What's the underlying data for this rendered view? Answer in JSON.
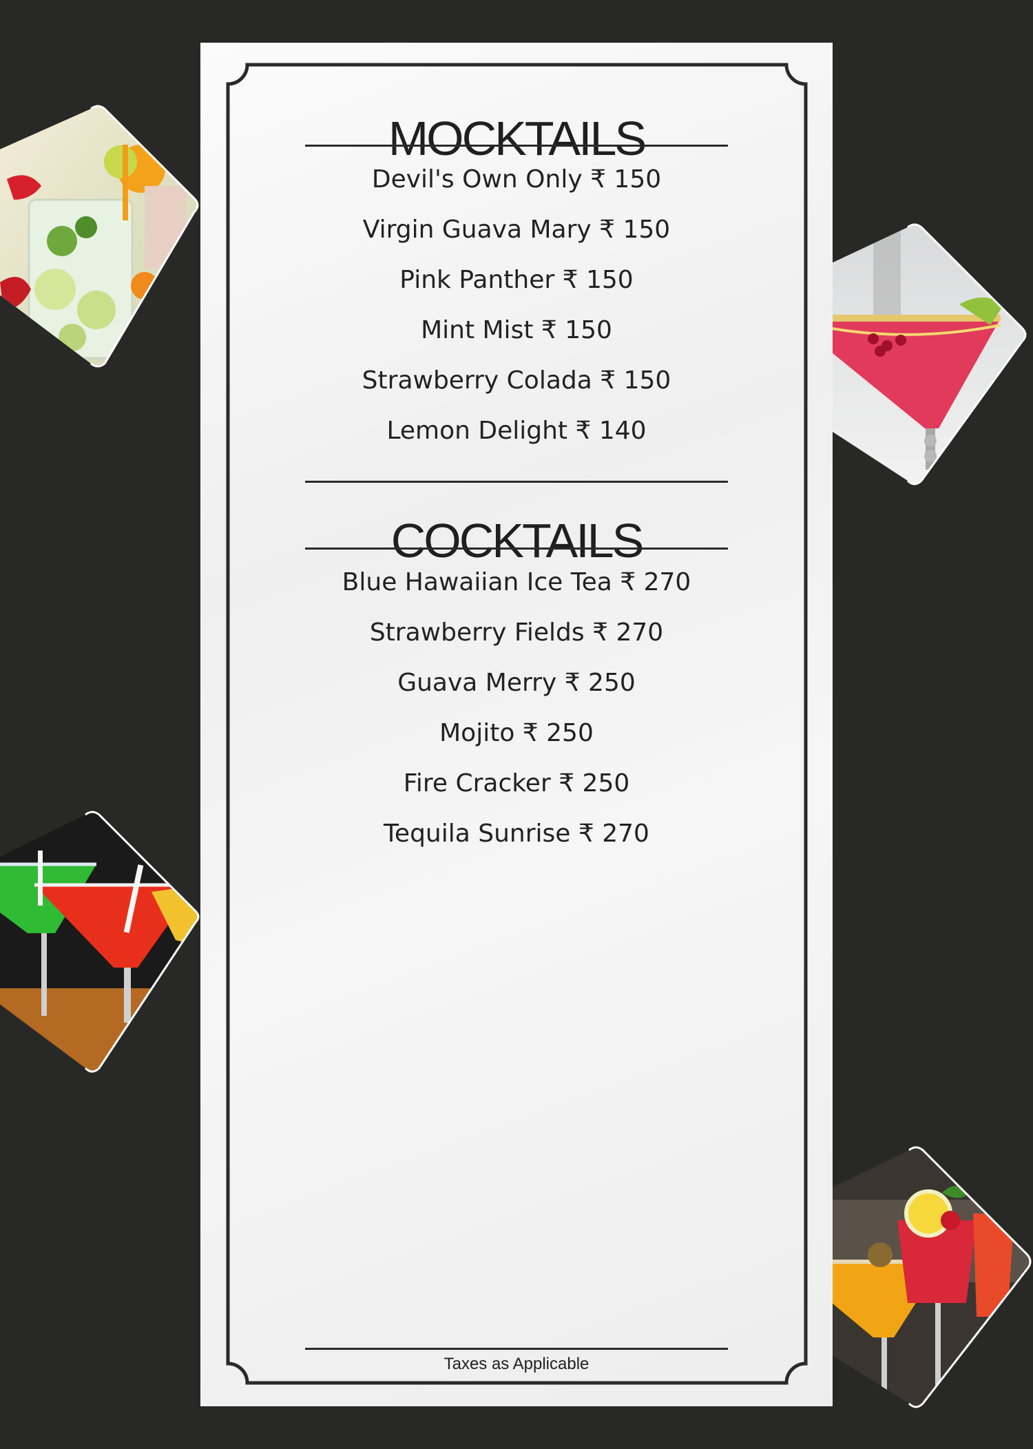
{
  "menu": {
    "mocktails": {
      "title": "MOCKTAILS",
      "items": [
        "Devil's Own Only ₹ 150",
        "Virgin Guava Mary ₹ 150",
        "Pink Panther ₹ 150",
        "Mint Mist ₹ 150",
        "Strawberry Colada ₹ 150",
        "Lemon Delight ₹ 140"
      ]
    },
    "cocktails": {
      "title": "COCKTAILS",
      "items": [
        "Blue Hawaiian Ice Tea ₹ 270",
        "Strawberry Fields ₹ 270",
        "Guava Merry ₹ 250",
        "Mojito ₹ 250",
        "Fire Cracker ₹ 250",
        "Tequila Sunrise ₹ 270"
      ]
    },
    "footer": "Taxes as Applicable"
  },
  "colors": {
    "background": "#282826",
    "panel": "#f4f4f4",
    "frame": "#2a2a2a",
    "text": "#222222"
  },
  "photos": [
    {
      "name": "mojito-photo",
      "subject": "glass of mojito with mint, lime and strawberries"
    },
    {
      "name": "cosmopolitan-photo",
      "subject": "red martini glass with sugared rim and lime"
    },
    {
      "name": "colorful-cocktails-photo",
      "subject": "green, red and yellow cocktails in martini glasses"
    },
    {
      "name": "citrus-cocktails-photo",
      "subject": "orange and red cocktails with lemon garnish"
    }
  ]
}
